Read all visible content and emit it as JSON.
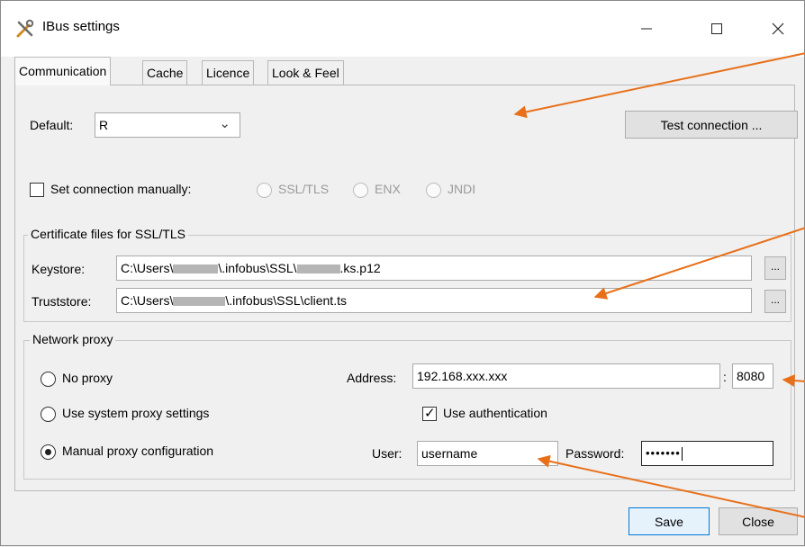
{
  "window": {
    "title": "IBus settings",
    "minimize_icon": "minimize-icon",
    "maximize_icon": "maximize-icon",
    "close_icon": "close-icon"
  },
  "tabs": [
    {
      "label": "Communication",
      "active": true
    },
    {
      "label": "Cache",
      "active": false
    },
    {
      "label": "Licence",
      "active": false
    },
    {
      "label": "Look & Feel",
      "active": false
    }
  ],
  "communication": {
    "default_label": "Default:",
    "default_value": "R",
    "test_connection_label": "Test connection ...",
    "set_manually_label": "Set connection manually:",
    "set_manually_checked": false,
    "radio_options": [
      "SSL/TLS",
      "ENX",
      "JNDI"
    ]
  },
  "certificates": {
    "legend": "Certificate files for SSL/TLS",
    "keystore_label": "Keystore:",
    "keystore_prefix": "C:\\Users\\",
    "keystore_mid": "\\.infobus\\SSL\\",
    "keystore_suffix": ".ks.p12",
    "truststore_label": "Truststore:",
    "truststore_prefix": "C:\\Users\\",
    "truststore_suffix": "\\.infobus\\SSL\\client.ts",
    "browse_label": "..."
  },
  "proxy": {
    "legend": "Network proxy",
    "no_proxy_label": "No proxy",
    "system_proxy_label": "Use system proxy settings",
    "manual_proxy_label": "Manual proxy configuration",
    "selected": "manual",
    "address_label": "Address:",
    "address_value": "192.168.xxx.xxx",
    "port_separator": ":",
    "port_value": "8080",
    "use_auth_label": "Use authentication",
    "use_auth_checked": true,
    "user_label": "User:",
    "user_value": "username",
    "password_label": "Password:",
    "password_value": "•••••••"
  },
  "footer": {
    "save_label": "Save",
    "close_label": "Close"
  },
  "colors": {
    "annotation_arrow": "#e8701a",
    "focus_border": "#0078d7"
  }
}
